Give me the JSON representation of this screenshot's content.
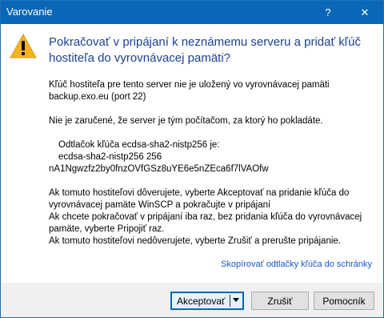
{
  "window": {
    "title": "Varovanie",
    "help_glyph": "?",
    "close_glyph": "✕"
  },
  "dialog": {
    "heading": "Pokračovať v pripájaní k neznámemu serveru a pridať kľúč hostiteľa do vyrovnávacej pamäti?",
    "line1": "Kľúč hostiteľa pre tento server nie je uložený vo vyrovnávacej pamäti",
    "line2": "backup.exo.eu (port 22)",
    "line3": "Nie je zaručené, že server je tým počítačom, za ktorý ho pokladáte.",
    "fp_label": "Odtlačok kľúča ecdsa-sha2-nistp256 je:",
    "fp_algo": "ecdsa-sha2-nistp256 256",
    "fp_value": "nA1Ngwzfz2by0fnzOVfGSz8uYE6e5nZEca6f7lVAOfw",
    "instr1": "Ak tomuto hostiteľovi dôverujete, vyberte Akceptovať na pridanie kľúča do vyrovnávacej pamäte WinSCP a pokračujte v pripájaní",
    "instr2": "Ak chcete pokračovať v pripájaní iba raz, bez pridania kľúča do vyrovnávacej pamäte, vyberte Pripojiť raz.",
    "instr3": "Ak tomuto hostiteľovi nedôverujete, vyberte Zrušiť a prerušte pripájanie.",
    "copy_link": "Skopírovať odtlačky kľúča do schránky"
  },
  "buttons": {
    "accept": "Akceptovať",
    "cancel": "Zrušiť",
    "help": "Pomocník"
  },
  "colors": {
    "titlebar": "#0a66b8",
    "heading": "#1c3f95",
    "link": "#1a56c7",
    "warning_icon": "#f5b324"
  },
  "icons": {
    "warning": "warning-icon",
    "split_arrow": "chevron-down-icon"
  }
}
